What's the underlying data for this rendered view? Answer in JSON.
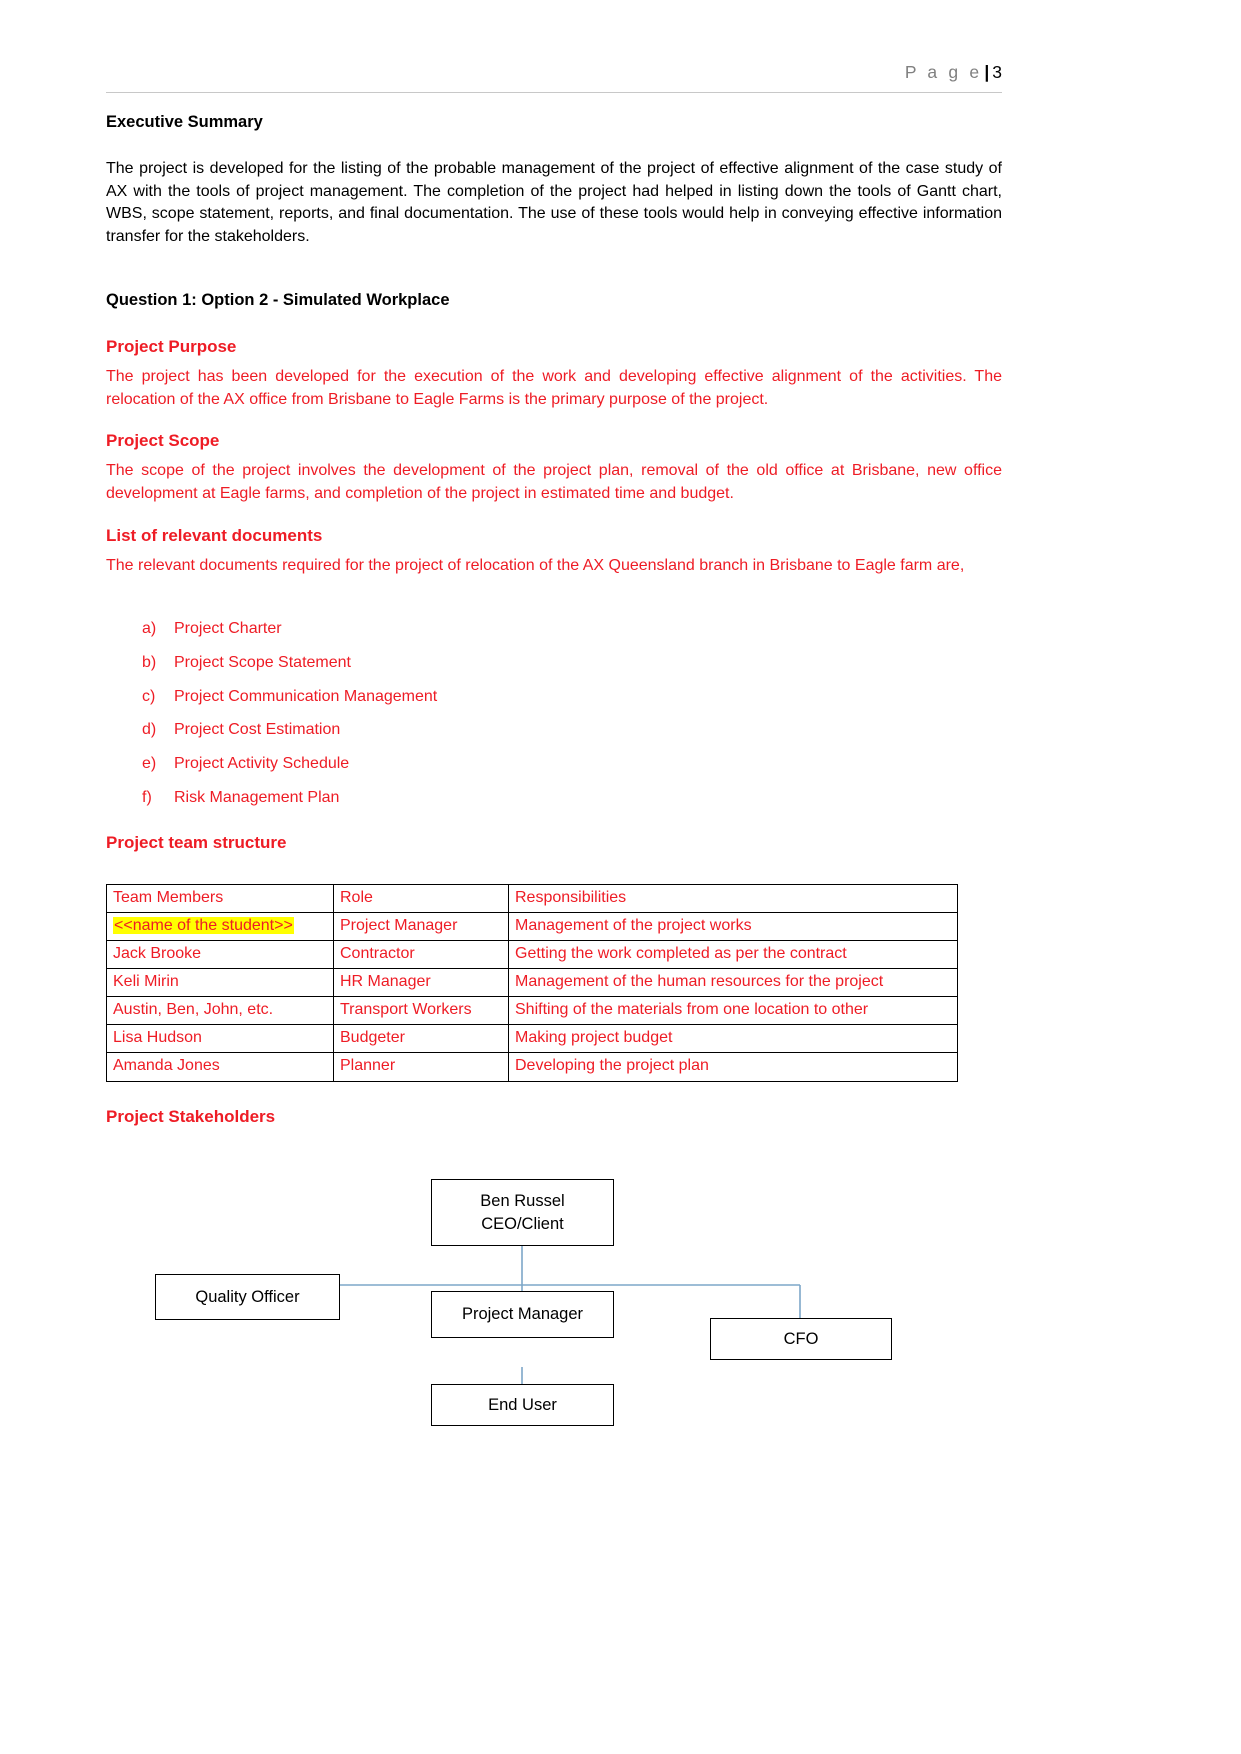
{
  "header": {
    "page_word": "P a g e",
    "separator": "|",
    "page_number": "3"
  },
  "sections": {
    "executive_summary": {
      "heading": "Executive Summary",
      "paragraph": "The project is developed for the listing of the probable management of the project of effective alignment of the case study of AX with the tools of project management. The completion of the project had helped in listing down the tools of Gantt chart, WBS, scope statement, reports, and final documentation. The use of these tools would help in conveying effective information transfer for the stakeholders."
    },
    "question_1": {
      "heading": "Question 1: Option 2 - Simulated Workplace"
    },
    "project_purpose": {
      "heading": "Project Purpose",
      "paragraph": "The project has been developed for the execution of the work and developing effective alignment of the activities. The relocation of the AX office from Brisbane to Eagle Farms is the primary purpose of the project."
    },
    "project_scope": {
      "heading": "Project Scope",
      "paragraph": "The scope of the project involves the development of the project plan, removal of the old office at Brisbane, new office development at Eagle farms, and completion of the project in estimated time and budget."
    },
    "relevant_documents": {
      "heading": "List of relevant documents",
      "paragraph": "The relevant documents required for the project of relocation of the AX Queensland branch in Brisbane to Eagle farm are,",
      "items": [
        {
          "marker": "a)",
          "label": "Project Charter"
        },
        {
          "marker": "b)",
          "label": "Project Scope Statement"
        },
        {
          "marker": "c)",
          "label": "Project Communication Management"
        },
        {
          "marker": "d)",
          "label": "Project Cost Estimation"
        },
        {
          "marker": "e)",
          "label": "Project Activity Schedule"
        },
        {
          "marker": "f)",
          "label": "Risk Management Plan"
        }
      ]
    },
    "team_structure": {
      "heading": "Project team structure",
      "columns": [
        "Team Members",
        "Role",
        "Responsibilities"
      ],
      "rows": [
        {
          "member": "<<name of the student>>",
          "role": "Project Manager",
          "responsibility": "Management of the project works",
          "highlight": true
        },
        {
          "member": "Jack Brooke",
          "role": "Contractor",
          "responsibility": "Getting the work completed as per the contract",
          "highlight": false
        },
        {
          "member": "Keli Mirin",
          "role": "HR Manager",
          "responsibility": "Management of the human resources for the project",
          "highlight": false
        },
        {
          "member": "Austin, Ben, John, etc.",
          "role": "Transport Workers",
          "responsibility": "Shifting of the materials from one location to other",
          "highlight": false
        },
        {
          "member": "Lisa Hudson",
          "role": "Budgeter",
          "responsibility": "Making project budget",
          "highlight": false
        },
        {
          "member": "Amanda Jones",
          "role": "Planner",
          "responsibility": "Developing the project plan",
          "highlight": false
        }
      ]
    },
    "stakeholders": {
      "heading": "Project Stakeholders",
      "nodes": [
        {
          "id": "ceo",
          "line1": "Ben Russel",
          "line2": "CEO/Client"
        },
        {
          "id": "quality-officer",
          "line1": "Quality Officer",
          "line2": ""
        },
        {
          "id": "project-manager",
          "line1": "Project Manager",
          "line2": ""
        },
        {
          "id": "cfo",
          "line1": "CFO",
          "line2": ""
        },
        {
          "id": "end-user",
          "line1": "End User",
          "line2": ""
        }
      ]
    }
  },
  "colors": {
    "accent_red": "#ee1c25",
    "connector_blue": "#7da7c8",
    "highlight_yellow": "#ffff00",
    "header_gray": "#808080"
  }
}
